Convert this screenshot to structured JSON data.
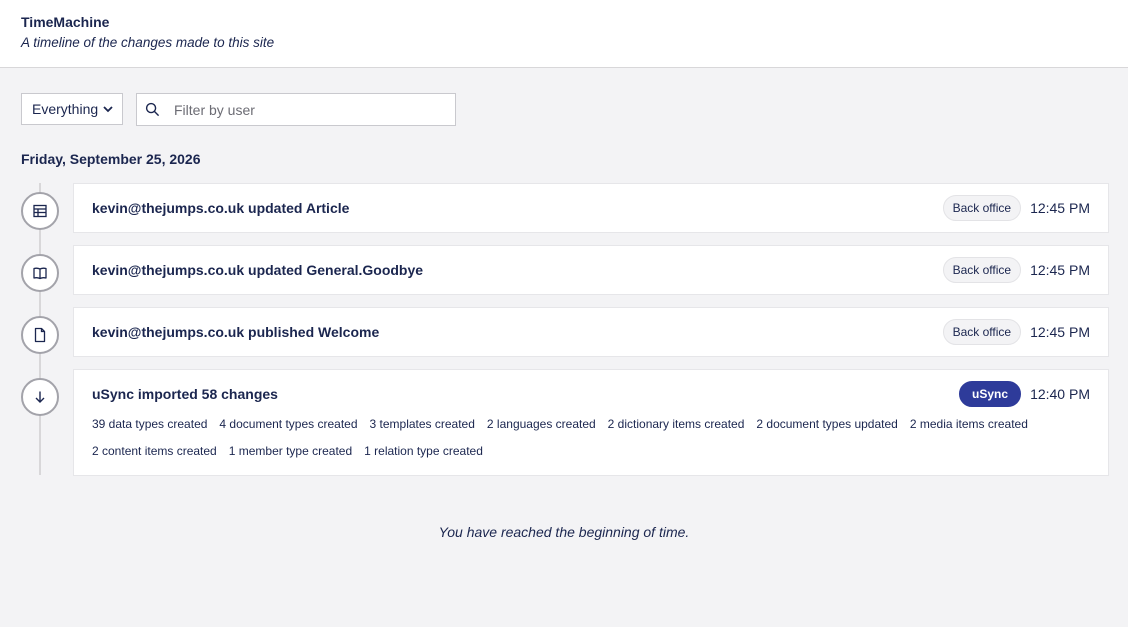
{
  "header": {
    "title": "TimeMachine",
    "subtitle": "A timeline of the changes made to this site"
  },
  "filters": {
    "type_selected": "Everything",
    "user_placeholder": "Filter by user"
  },
  "date_heading": "Friday, September 25, 2026",
  "entries": [
    {
      "icon": "table-icon",
      "message": "kevin@thejumps.co.uk updated Article",
      "source": "Back office",
      "time": "12:45 PM"
    },
    {
      "icon": "book-icon",
      "message": "kevin@thejumps.co.uk updated General.Goodbye",
      "source": "Back office",
      "time": "12:45 PM"
    },
    {
      "icon": "document-icon",
      "message": "kevin@thejumps.co.uk published Welcome",
      "source": "Back office",
      "time": "12:45 PM"
    },
    {
      "icon": "arrow-down-icon",
      "message": "uSync imported 58 changes",
      "source": "uSync",
      "time": "12:40 PM",
      "changes": [
        "39 data types created",
        "4 document types created",
        "3 templates created",
        "2 languages created",
        "2 dictionary items created",
        "2 document types updated",
        "2 media items created",
        "2 content items created",
        "1 member type created",
        "1 relation type created"
      ]
    }
  ],
  "footer_message": "You have reached the beginning of time.",
  "colors": {
    "text": "#1b264f",
    "usync_badge": "#2e3b9a",
    "background": "#f3f3f5"
  }
}
